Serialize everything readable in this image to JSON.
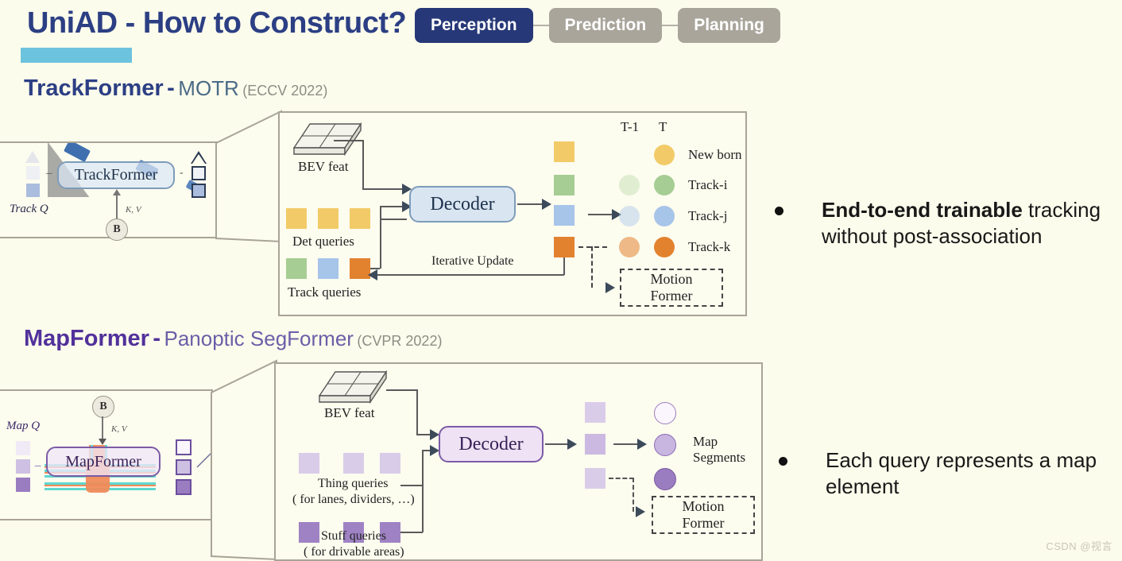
{
  "page": {
    "title": "UniAD - How to Construct?",
    "background": "#fcfcec",
    "watermark": "CSDN @视言"
  },
  "nav": {
    "items": [
      {
        "label": "Perception",
        "state": "active",
        "color": "#263877"
      },
      {
        "label": "Prediction",
        "state": "idle",
        "color": "#a9a59b"
      },
      {
        "label": "Planning",
        "state": "idle",
        "color": "#a9a59b"
      }
    ]
  },
  "sections": [
    {
      "id": "trackformer",
      "name": "TrackFormer",
      "dash": "-",
      "subtitle": "MOTR",
      "venue": "(ECCV 2022)",
      "accent": "#2c3f84",
      "thumbnail": {
        "input_label": "Track Q",
        "module_label": "TrackFormer",
        "attn_label": "K, V",
        "backbone_label": "B",
        "dash_left": "–",
        "dash_right": "-"
      },
      "diagram": {
        "bev_label": "BEV feat",
        "decoder_label": "Decoder",
        "det_queries_label": "Det queries",
        "track_queries_label": "Track queries",
        "iterative_label": "Iterative Update",
        "time_prev": "T-1",
        "time_now": "T",
        "motion_former": [
          "Motion",
          "Former"
        ],
        "tracks": [
          {
            "label": "New born",
            "color": "#f2cb68",
            "prev": false
          },
          {
            "label": "Track-i",
            "color": "#a6cd93",
            "prev": true
          },
          {
            "label": "Track-j",
            "color": "#a7c4e9",
            "prev": true
          },
          {
            "label": "Track-k",
            "color": "#e2822f",
            "prev": true
          }
        ],
        "det_query_colors": [
          "#f2cb68",
          "#f2cb68",
          "#f2cb68"
        ],
        "track_query_colors": [
          "#a6cd93",
          "#a7c4e9",
          "#e2822f"
        ],
        "output_colors": [
          "#f2cb68",
          "#a6cd93",
          "#a7c4e9",
          "#e2822f"
        ]
      },
      "bullet": {
        "bold": "End-to-end trainable",
        "rest": " tracking without post-association"
      }
    },
    {
      "id": "mapformer",
      "name": "MapFormer",
      "dash": "-",
      "subtitle": "Panoptic SegFormer",
      "venue": "(CVPR 2022)",
      "accent": "#51319b",
      "thumbnail": {
        "input_label": "Map Q",
        "module_label": "MapFormer",
        "attn_label": "K, V",
        "backbone_label": "B",
        "dash_left": "–"
      },
      "diagram": {
        "bev_label": "BEV feat",
        "decoder_label": "Decoder",
        "thing_queries_label": "Thing queries",
        "thing_queries_sub": "( for lanes, dividers, …)",
        "stuff_queries_label": "Stuff queries",
        "stuff_queries_sub": "( for drivable areas)",
        "map_segments": [
          "Map",
          "Segments"
        ],
        "motion_former": [
          "Motion",
          "Former"
        ],
        "thing_query_colors": [
          "#d9cce9",
          "#d9cce9",
          "#d9cce9"
        ],
        "stuff_query_colors": [
          "#9f82c4",
          "#9f82c4",
          "#9f82c4"
        ],
        "output_colors": [
          "#d9cce9",
          "#cbb9e2",
          "#d9cce9"
        ],
        "segment_colors": [
          "#fbf6fd",
          "#c8b5e0",
          "#9a7cc0"
        ]
      },
      "bullet": {
        "bold": "",
        "rest": "Each query represents a map element"
      }
    }
  ]
}
